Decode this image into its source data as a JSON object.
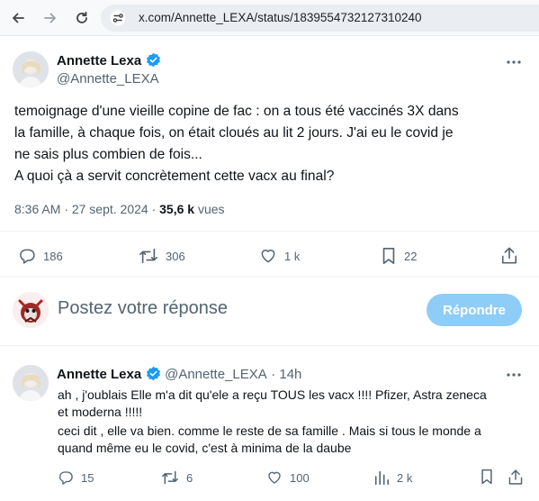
{
  "browser": {
    "url": "x.com/Annette_LEXA/status/1839554732127310240"
  },
  "tweet": {
    "author_name": "Annette Lexa",
    "author_handle": "@Annette_LEXA",
    "lines": [
      "temoignage d'une vieille copine  de fac : on a tous été vaccinés 3X dans",
      "la famille, à chaque fois, on était cloués au lit  2 jours. J'ai eu le covid je",
      "ne sais plus combien de fois...",
      "A quoi çà a servit concrètement cette vacx au final?"
    ],
    "time": "8:36 AM",
    "dot": "·",
    "date": "27 sept. 2024",
    "views_count": "35,6 k",
    "views_label": "vues",
    "stats": {
      "replies": "186",
      "retweets": "306",
      "likes": "1 k",
      "bookmarks": "22"
    }
  },
  "reply_box": {
    "placeholder": "Postez votre réponse",
    "button": "Répondre"
  },
  "reply": {
    "author_name": "Annette Lexa",
    "author_handle": "@Annette_LEXA",
    "time": "· 14h",
    "lines": [
      "ah , j'oublais Elle m'a dit qu'ele a reçu TOUS les vacx !!!! Pfizer, Astra zeneca",
      "et moderna !!!!!",
      "ceci dit , elle va bien. comme le reste de sa famille . Mais si tous le monde a",
      "quand même eu le covid, c'est à minima de la daube"
    ],
    "stats": {
      "replies": "15",
      "retweets": "6",
      "likes": "100",
      "views": "2 k"
    }
  },
  "colors": {
    "verified": "#1d9bf0",
    "muted": "#536471",
    "reply_button": "#8ecdf8"
  }
}
